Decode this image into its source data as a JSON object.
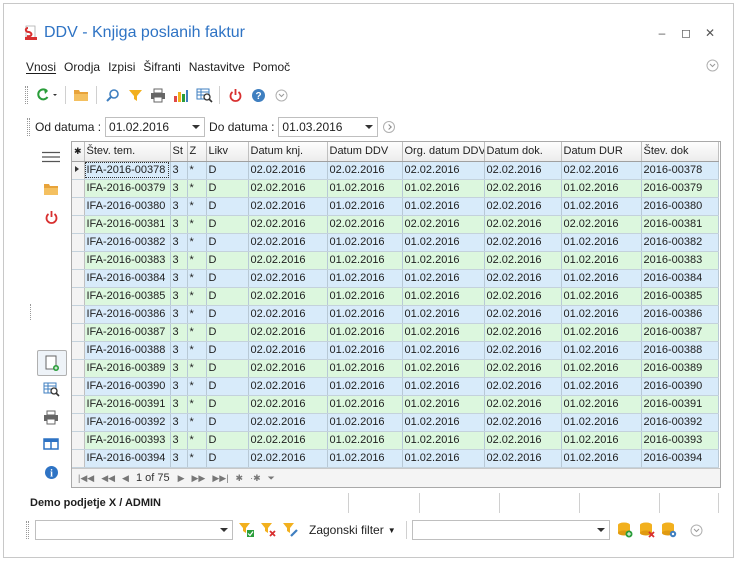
{
  "window": {
    "title": "DDV - Knjiga poslanih faktur",
    "controls": {
      "minimize": "–",
      "maximize": "◻",
      "close": "✕"
    }
  },
  "menu": {
    "items": [
      "Vnosi",
      "Orodja",
      "Izpisi",
      "Šifranti",
      "Nastavitve",
      "Pomoč"
    ]
  },
  "date_filter": {
    "from_label": "Od datuma :",
    "from_value": "01.02.2016",
    "to_label": "Do datuma :",
    "to_value": "01.03.2016"
  },
  "grid": {
    "columns": [
      "Štev. tem.",
      "St",
      "Z",
      "Likv",
      "Datum knj.",
      "Datum DDV",
      "Org. datum DDV",
      "Datum dok.",
      "Datum DUR",
      "Štev. dok"
    ],
    "rows": [
      [
        "IFA-2016-00378",
        "3",
        "*",
        "D",
        "02.02.2016",
        "02.02.2016",
        "02.02.2016",
        "02.02.2016",
        "02.02.2016",
        "2016-00378"
      ],
      [
        "IFA-2016-00379",
        "3",
        "*",
        "D",
        "02.02.2016",
        "01.02.2016",
        "01.02.2016",
        "02.02.2016",
        "01.02.2016",
        "2016-00379"
      ],
      [
        "IFA-2016-00380",
        "3",
        "*",
        "D",
        "02.02.2016",
        "01.02.2016",
        "01.02.2016",
        "02.02.2016",
        "01.02.2016",
        "2016-00380"
      ],
      [
        "IFA-2016-00381",
        "3",
        "*",
        "D",
        "02.02.2016",
        "02.02.2016",
        "02.02.2016",
        "02.02.2016",
        "02.02.2016",
        "2016-00381"
      ],
      [
        "IFA-2016-00382",
        "3",
        "*",
        "D",
        "02.02.2016",
        "01.02.2016",
        "01.02.2016",
        "02.02.2016",
        "01.02.2016",
        "2016-00382"
      ],
      [
        "IFA-2016-00383",
        "3",
        "*",
        "D",
        "02.02.2016",
        "01.02.2016",
        "01.02.2016",
        "02.02.2016",
        "01.02.2016",
        "2016-00383"
      ],
      [
        "IFA-2016-00384",
        "3",
        "*",
        "D",
        "02.02.2016",
        "01.02.2016",
        "01.02.2016",
        "02.02.2016",
        "01.02.2016",
        "2016-00384"
      ],
      [
        "IFA-2016-00385",
        "3",
        "*",
        "D",
        "02.02.2016",
        "01.02.2016",
        "01.02.2016",
        "02.02.2016",
        "01.02.2016",
        "2016-00385"
      ],
      [
        "IFA-2016-00386",
        "3",
        "*",
        "D",
        "02.02.2016",
        "01.02.2016",
        "01.02.2016",
        "02.02.2016",
        "01.02.2016",
        "2016-00386"
      ],
      [
        "IFA-2016-00387",
        "3",
        "*",
        "D",
        "02.02.2016",
        "01.02.2016",
        "01.02.2016",
        "02.02.2016",
        "01.02.2016",
        "2016-00387"
      ],
      [
        "IFA-2016-00388",
        "3",
        "*",
        "D",
        "02.02.2016",
        "01.02.2016",
        "01.02.2016",
        "02.02.2016",
        "01.02.2016",
        "2016-00388"
      ],
      [
        "IFA-2016-00389",
        "3",
        "*",
        "D",
        "02.02.2016",
        "01.02.2016",
        "01.02.2016",
        "02.02.2016",
        "01.02.2016",
        "2016-00389"
      ],
      [
        "IFA-2016-00390",
        "3",
        "*",
        "D",
        "02.02.2016",
        "01.02.2016",
        "01.02.2016",
        "02.02.2016",
        "01.02.2016",
        "2016-00390"
      ],
      [
        "IFA-2016-00391",
        "3",
        "*",
        "D",
        "02.02.2016",
        "01.02.2016",
        "01.02.2016",
        "02.02.2016",
        "01.02.2016",
        "2016-00391"
      ],
      [
        "IFA-2016-00392",
        "3",
        "*",
        "D",
        "02.02.2016",
        "01.02.2016",
        "01.02.2016",
        "02.02.2016",
        "01.02.2016",
        "2016-00392"
      ],
      [
        "IFA-2016-00393",
        "3",
        "*",
        "D",
        "02.02.2016",
        "01.02.2016",
        "01.02.2016",
        "02.02.2016",
        "01.02.2016",
        "2016-00393"
      ],
      [
        "IFA-2016-00394",
        "3",
        "*",
        "D",
        "02.02.2016",
        "01.02.2016",
        "01.02.2016",
        "02.02.2016",
        "01.02.2016",
        "2016-00394"
      ]
    ],
    "row_colors": [
      "blue",
      "green",
      "blue",
      "green",
      "blue",
      "green",
      "blue",
      "green",
      "blue",
      "green",
      "blue",
      "green",
      "blue",
      "green",
      "blue",
      "green",
      "blue"
    ],
    "pager": "1 of 75",
    "header_glyph": "✱"
  },
  "status": {
    "text": "Demo podjetje X / ADMIN"
  },
  "filter_bar": {
    "label": "Zagonski filter"
  },
  "colors": {
    "title_blue": "#2e73c4",
    "row_blue": "#d8ebfa",
    "row_green": "#dcf7de",
    "refresh_green": "#2a9d3a",
    "power_red": "#d83030"
  },
  "icons": {
    "toolbar": [
      "refresh-icon",
      "folder-icon",
      "search-icon",
      "filter-icon",
      "print-icon",
      "chart-icon",
      "grid-search-icon",
      "power-icon",
      "help-icon"
    ],
    "sidebar": [
      "hamburger-icon",
      "folder-icon",
      "power-icon",
      "new-document-icon",
      "grid-search-icon",
      "print-icon",
      "columns-icon",
      "info-icon"
    ]
  }
}
